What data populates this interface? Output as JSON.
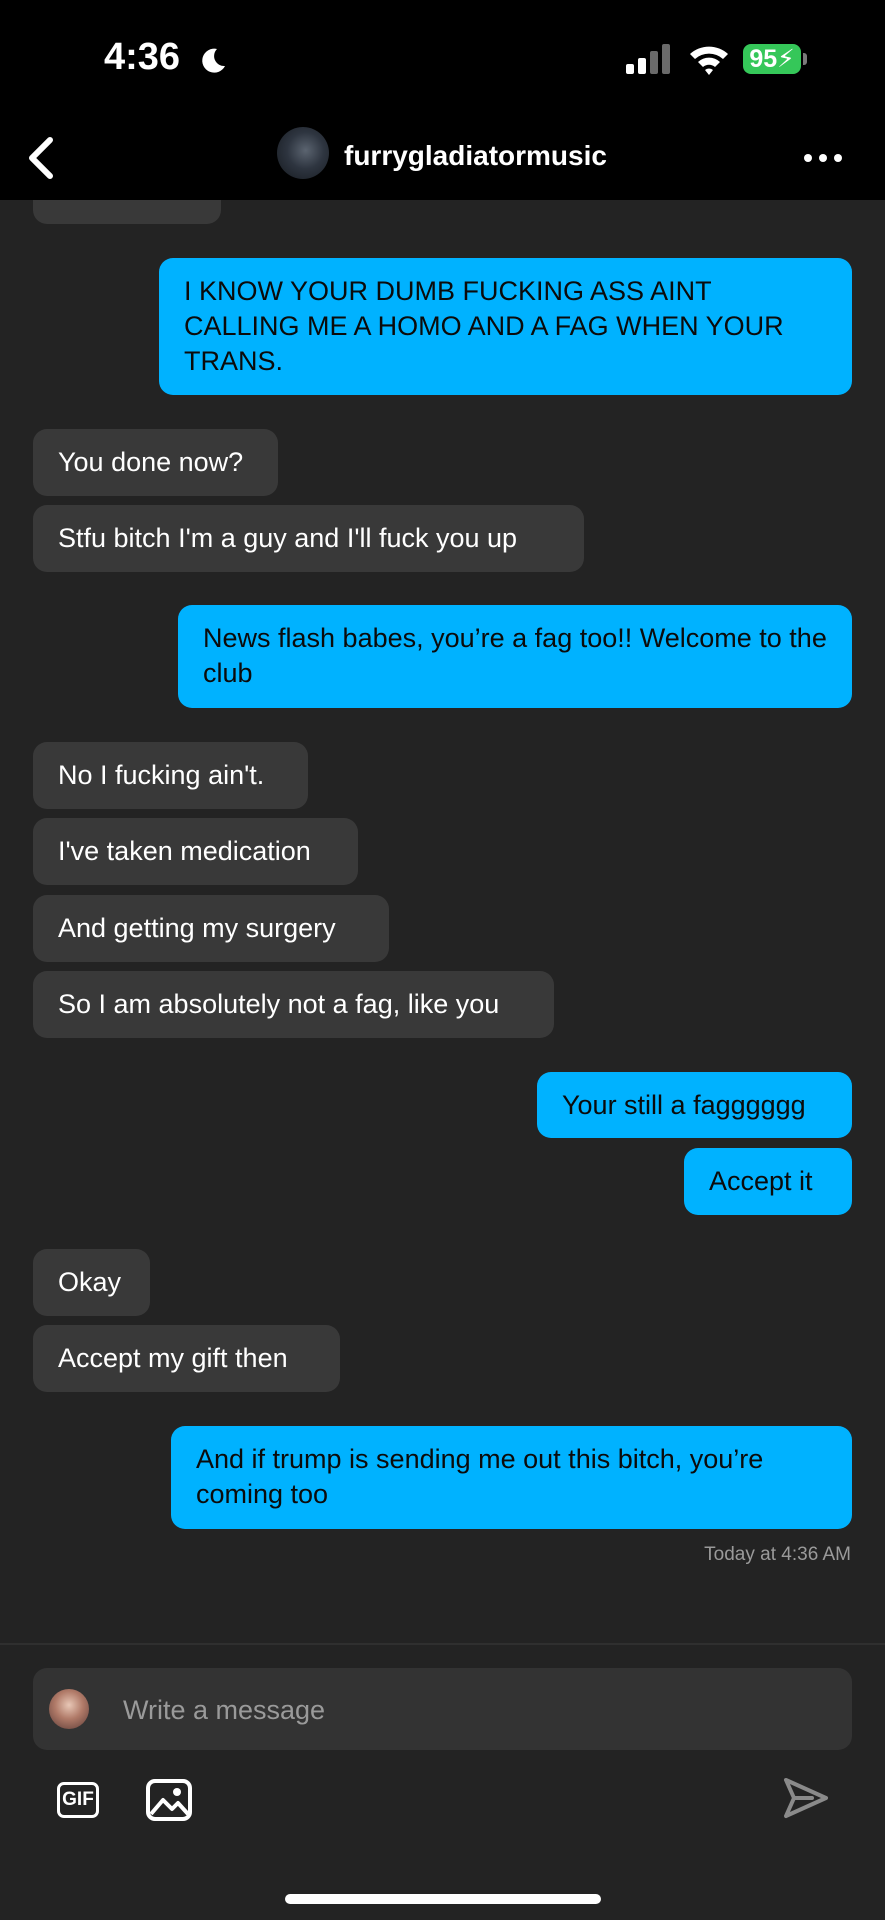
{
  "status_bar": {
    "time": "4:36",
    "battery": "95"
  },
  "header": {
    "username": "furrygladiatormusic"
  },
  "messages": [
    {
      "side": "received",
      "text": ""
    },
    {
      "side": "sent",
      "text": "I KNOW YOUR DUMB FUCKING ASS AINT CALLING ME A HOMO AND A FAG WHEN YOUR TRANS."
    },
    {
      "side": "received",
      "text": "You done now?"
    },
    {
      "side": "received",
      "text": "Stfu bitch I'm a guy and I'll fuck you up"
    },
    {
      "side": "sent",
      "text": "News flash babes, you’re a fag too!! Welcome to the club"
    },
    {
      "side": "received",
      "text": "No I fucking ain't."
    },
    {
      "side": "received",
      "text": "I've taken medication"
    },
    {
      "side": "received",
      "text": "And getting my surgery"
    },
    {
      "side": "received",
      "text": "So I am absolutely not a fag, like you"
    },
    {
      "side": "sent",
      "text": "Your still a fagggggg"
    },
    {
      "side": "sent",
      "text": "Accept it"
    },
    {
      "side": "received",
      "text": "Okay"
    },
    {
      "side": "received",
      "text": "Accept my gift then"
    },
    {
      "side": "sent",
      "text": "And if trump is sending me out this bitch, you’re coming too"
    }
  ],
  "timestamp": "Today at 4:36 AM",
  "composer": {
    "placeholder": "Write a message",
    "gif_label": "GIF"
  },
  "icons": {
    "back": "chevron-left-icon",
    "more": "more-dots-icon",
    "image": "image-icon",
    "send": "send-icon"
  },
  "colors": {
    "sent_bubble": "#00b2ff",
    "received_bubble": "#393939",
    "background": "#232323"
  }
}
